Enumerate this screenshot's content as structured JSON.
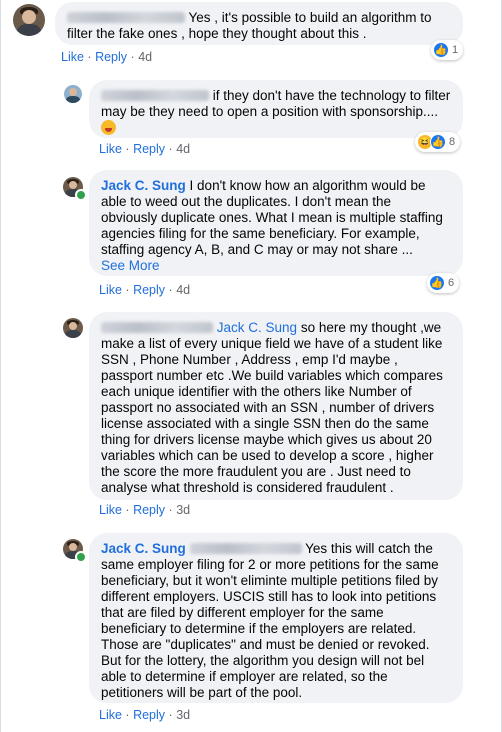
{
  "comments": [
    {
      "text": "Yes , it's possible to build an algorithm to filter the fake ones , hope they thought about this .",
      "actions": {
        "like": "Like",
        "reply": "Reply",
        "time": "4d"
      },
      "reaction": {
        "icons": [
          "like-icon"
        ],
        "count": "1"
      }
    },
    {
      "text": "if they don't have the technology to filter may be they need to open a position with sponsorship....",
      "actions": {
        "like": "Like",
        "reply": "Reply",
        "time": "4d"
      },
      "reaction": {
        "icons": [
          "haha-icon",
          "like-icon"
        ],
        "count": "8"
      }
    },
    {
      "author": "Jack C. Sung",
      "text": "I don't know how an algorithm would be able to weed out the duplicates. I don't mean the obviously duplicate ones. What I mean is multiple staffing agencies filing for the same beneficiary. For example, staffing agency A, B, and C may or may not share ...",
      "see_more": "See More",
      "actions": {
        "like": "Like",
        "reply": "Reply",
        "time": "4d"
      },
      "reaction": {
        "icons": [
          "like-icon"
        ],
        "count": "6"
      }
    },
    {
      "mention": "Jack C. Sung",
      "text": "so here my thought ,we make a list of every unique field we have of a student like SSN , Phone Number , Address , emp I'd maybe , passport number etc .We build variables which compares each unique identifier with the others like Number of passport no associated with an SSN , number of drivers license associated with a single SSN then do the same thing for drivers license maybe which gives us about 20 variables which can be used to develop a score , higher the score the more fraudulent you are . Just need to analyse what threshold is considered fraudulent .",
      "actions": {
        "like": "Like",
        "reply": "Reply",
        "time": "3d"
      }
    },
    {
      "author": "Jack C. Sung",
      "text": "Yes this will catch the same employer filing for 2 or more petitions for the same beneficiary, but it won't eliminte multiple petitions filed by different employers. USCIS still has to look into petitions that are filed by different employer for the same beneficiary to determine if the employers are related. Those are \"duplicates\" and must be denied or revoked. But for the lottery, the algorithm you design will not bel able to determine if employer are related, so the petitioners will be part of the pool.",
      "actions": {
        "like": "Like",
        "reply": "Reply",
        "time": "3d"
      }
    }
  ]
}
